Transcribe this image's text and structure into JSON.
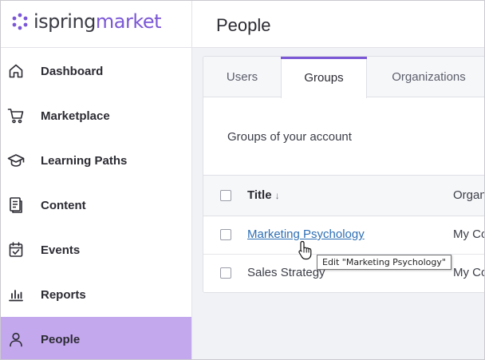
{
  "logo": {
    "part1": "ispring",
    "part2": "market"
  },
  "sidebar": {
    "items": [
      {
        "label": "Dashboard",
        "icon": "home-icon"
      },
      {
        "label": "Marketplace",
        "icon": "cart-icon"
      },
      {
        "label": "Learning Paths",
        "icon": "graduation-cap-icon"
      },
      {
        "label": "Content",
        "icon": "document-icon"
      },
      {
        "label": "Events",
        "icon": "calendar-check-icon"
      },
      {
        "label": "Reports",
        "icon": "bar-chart-icon"
      },
      {
        "label": "People",
        "icon": "person-icon",
        "active": true
      }
    ]
  },
  "header": {
    "title": "People"
  },
  "tabs": [
    {
      "label": "Users"
    },
    {
      "label": "Groups",
      "active": true
    },
    {
      "label": "Organizations"
    }
  ],
  "section": {
    "title": "Groups of your account"
  },
  "table": {
    "columns": {
      "title": "Title",
      "title_sort": "↓",
      "org": "Organ"
    },
    "rows": [
      {
        "title": "Marketing Psychology",
        "org": "My Co"
      },
      {
        "title": "Sales Strategy",
        "org": "My Co"
      }
    ]
  },
  "tooltip": {
    "text": "Edit \"Marketing Psychology\""
  },
  "colors": {
    "accent": "#7b57d6",
    "active_nav": "#c4a8ee",
    "link": "#2f6fb5"
  }
}
